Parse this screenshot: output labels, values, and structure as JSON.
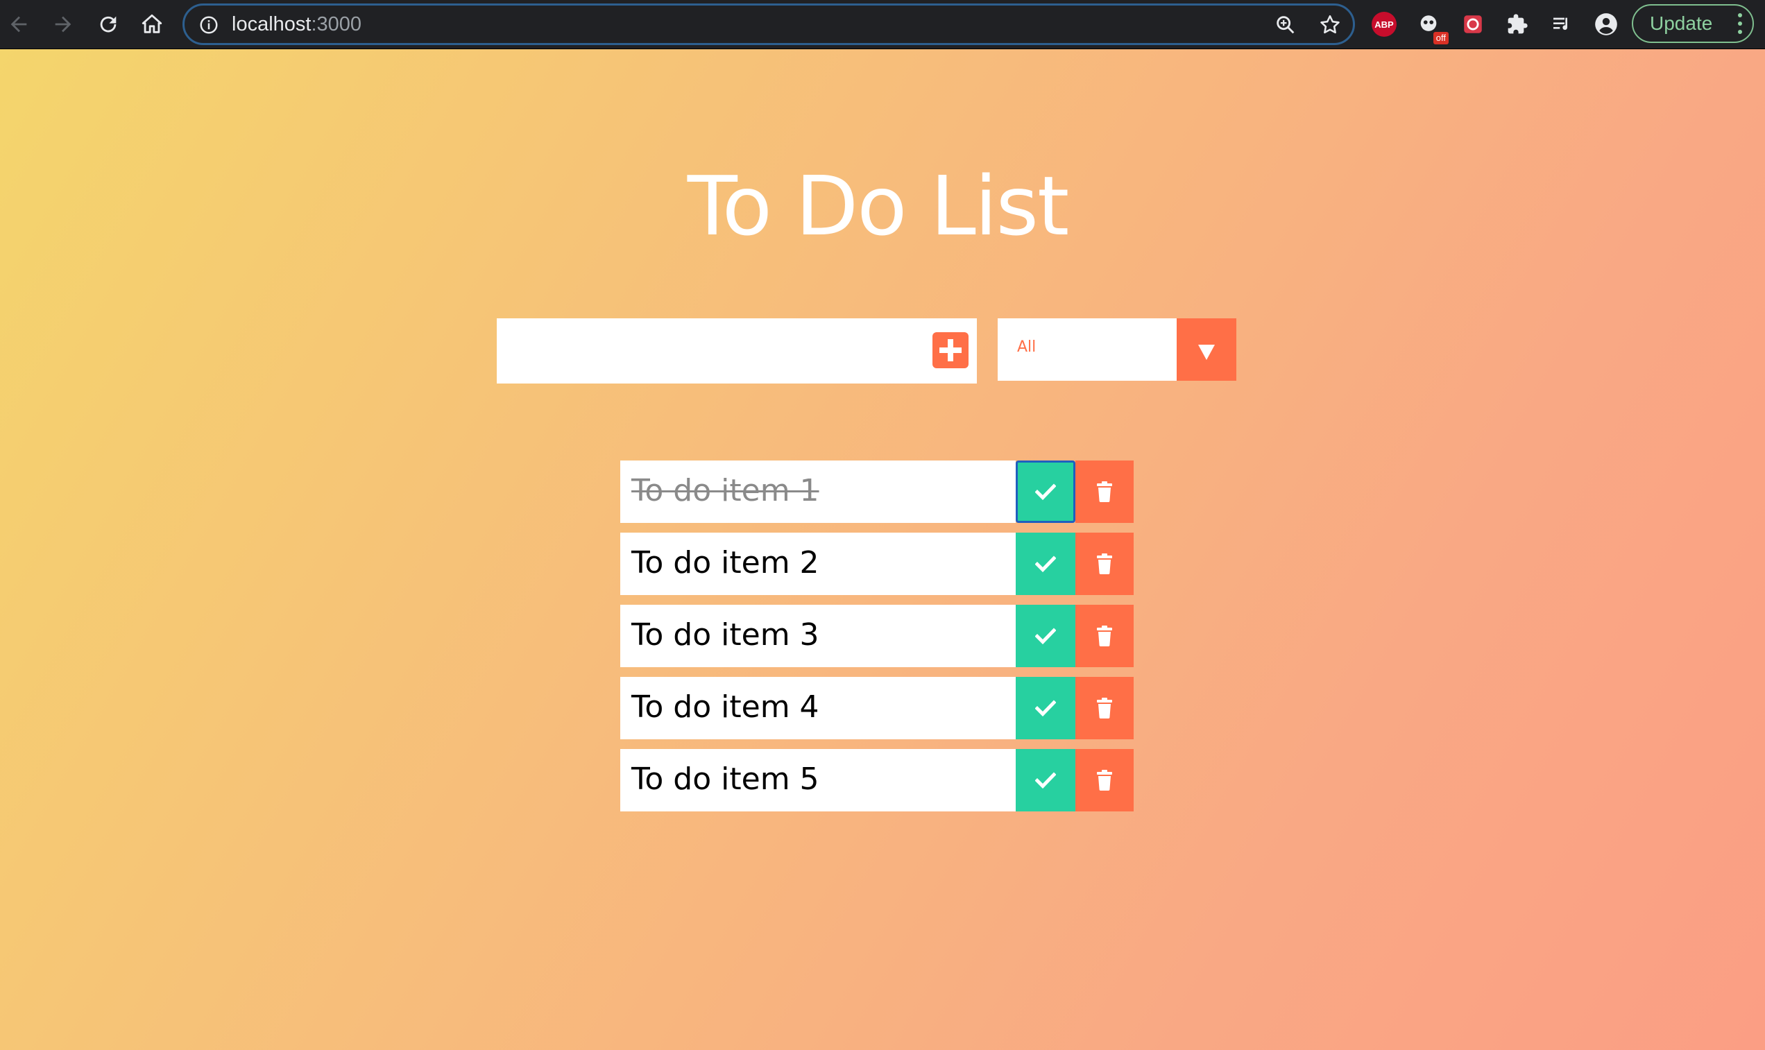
{
  "browser": {
    "url_host": "localhost",
    "url_port": ":3000",
    "update_label": "Update",
    "extensions": {
      "abp_label": "ABP",
      "off_badge": "off"
    },
    "icons": [
      "back-arrow-icon",
      "forward-arrow-icon",
      "reload-icon",
      "home-icon",
      "info-icon",
      "zoom-icon",
      "bookmark-star-icon",
      "abp-icon",
      "extension-off-icon",
      "extension-red-icon",
      "puzzle-icon",
      "reading-list-icon",
      "profile-icon",
      "kebab-menu-icon"
    ]
  },
  "app": {
    "title": "To Do List",
    "input": {
      "value": "",
      "placeholder": ""
    },
    "filter": {
      "selected": "All"
    },
    "todos": [
      {
        "text": "To do item 1",
        "completed": true
      },
      {
        "text": "To do item 2",
        "completed": false
      },
      {
        "text": "To do item 3",
        "completed": false
      },
      {
        "text": "To do item 4",
        "completed": false
      },
      {
        "text": "To do item 5",
        "completed": false
      }
    ]
  },
  "colors": {
    "accent": "#ff6f47",
    "check": "#27d0a0",
    "gradient_start": "#f4d56c",
    "gradient_end": "#fb9e84"
  }
}
